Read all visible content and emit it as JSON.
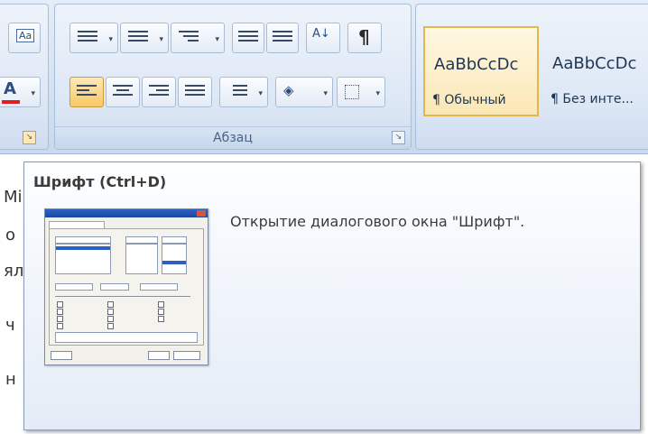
{
  "ribbon": {
    "font_group": {
      "launcher": "Диалоговое окно Шрифт"
    },
    "paragraph_group": {
      "label": "Абзац"
    },
    "styles": [
      {
        "sample": "AaBbCcDc",
        "name": "¶ Обычный",
        "selected": true
      },
      {
        "sample": "AaBbCcDc",
        "name": "¶ Без инте...",
        "selected": false
      }
    ]
  },
  "document_fragments": [
    "Mi",
    "о",
    "ял",
    "ч",
    "н"
  ],
  "tooltip": {
    "title": "Шрифт (Ctrl+D)",
    "description": "Открытие диалогового окна \"Шрифт\"."
  },
  "colors": {
    "font_color": "#e02020",
    "highlight_selected": "#f8c866"
  }
}
